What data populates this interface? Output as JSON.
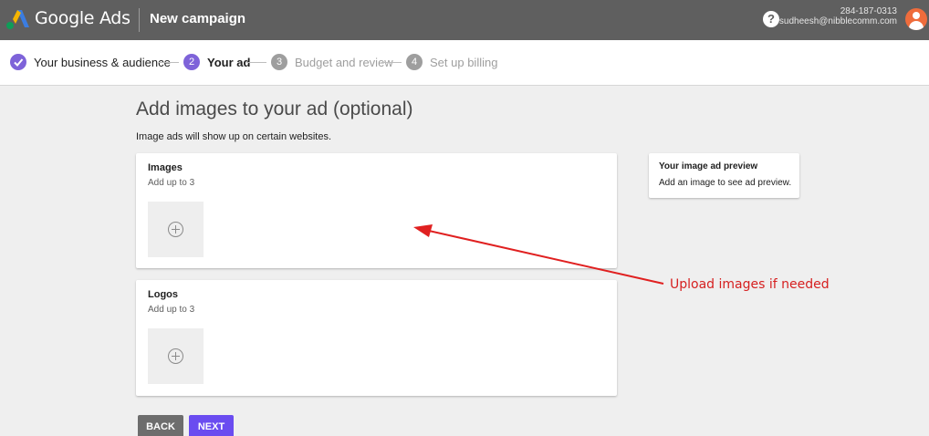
{
  "header": {
    "brand": "Google Ads",
    "title": "New campaign",
    "help_icon": "help-circle-icon",
    "account_phone": "284-187-0313",
    "account_email": "sudheesh@nibblecomm.com"
  },
  "stepper": {
    "steps": [
      {
        "number": "",
        "label": "Your business & audience",
        "state": "done"
      },
      {
        "number": "2",
        "label": "Your ad",
        "state": "active"
      },
      {
        "number": "3",
        "label": "Budget and review",
        "state": "todo"
      },
      {
        "number": "4",
        "label": "Set up billing",
        "state": "todo"
      }
    ]
  },
  "main": {
    "title": "Add images to your ad (optional)",
    "subtitle": "Image ads will show up on certain websites.",
    "images_card": {
      "title": "Images",
      "subtitle": "Add up to 3"
    },
    "logos_card": {
      "title": "Logos",
      "subtitle": "Add up to 3"
    },
    "preview": {
      "title": "Your image ad preview",
      "subtitle": "Add an image to see ad preview."
    }
  },
  "annotation": {
    "text": "Upload images if needed",
    "color": "#d62020"
  },
  "buttons": {
    "back": "BACK",
    "next": "NEXT"
  },
  "colors": {
    "accent": "#6a4cf0",
    "step_done": "#7e63d9",
    "topbar": "#5f5f5f"
  }
}
